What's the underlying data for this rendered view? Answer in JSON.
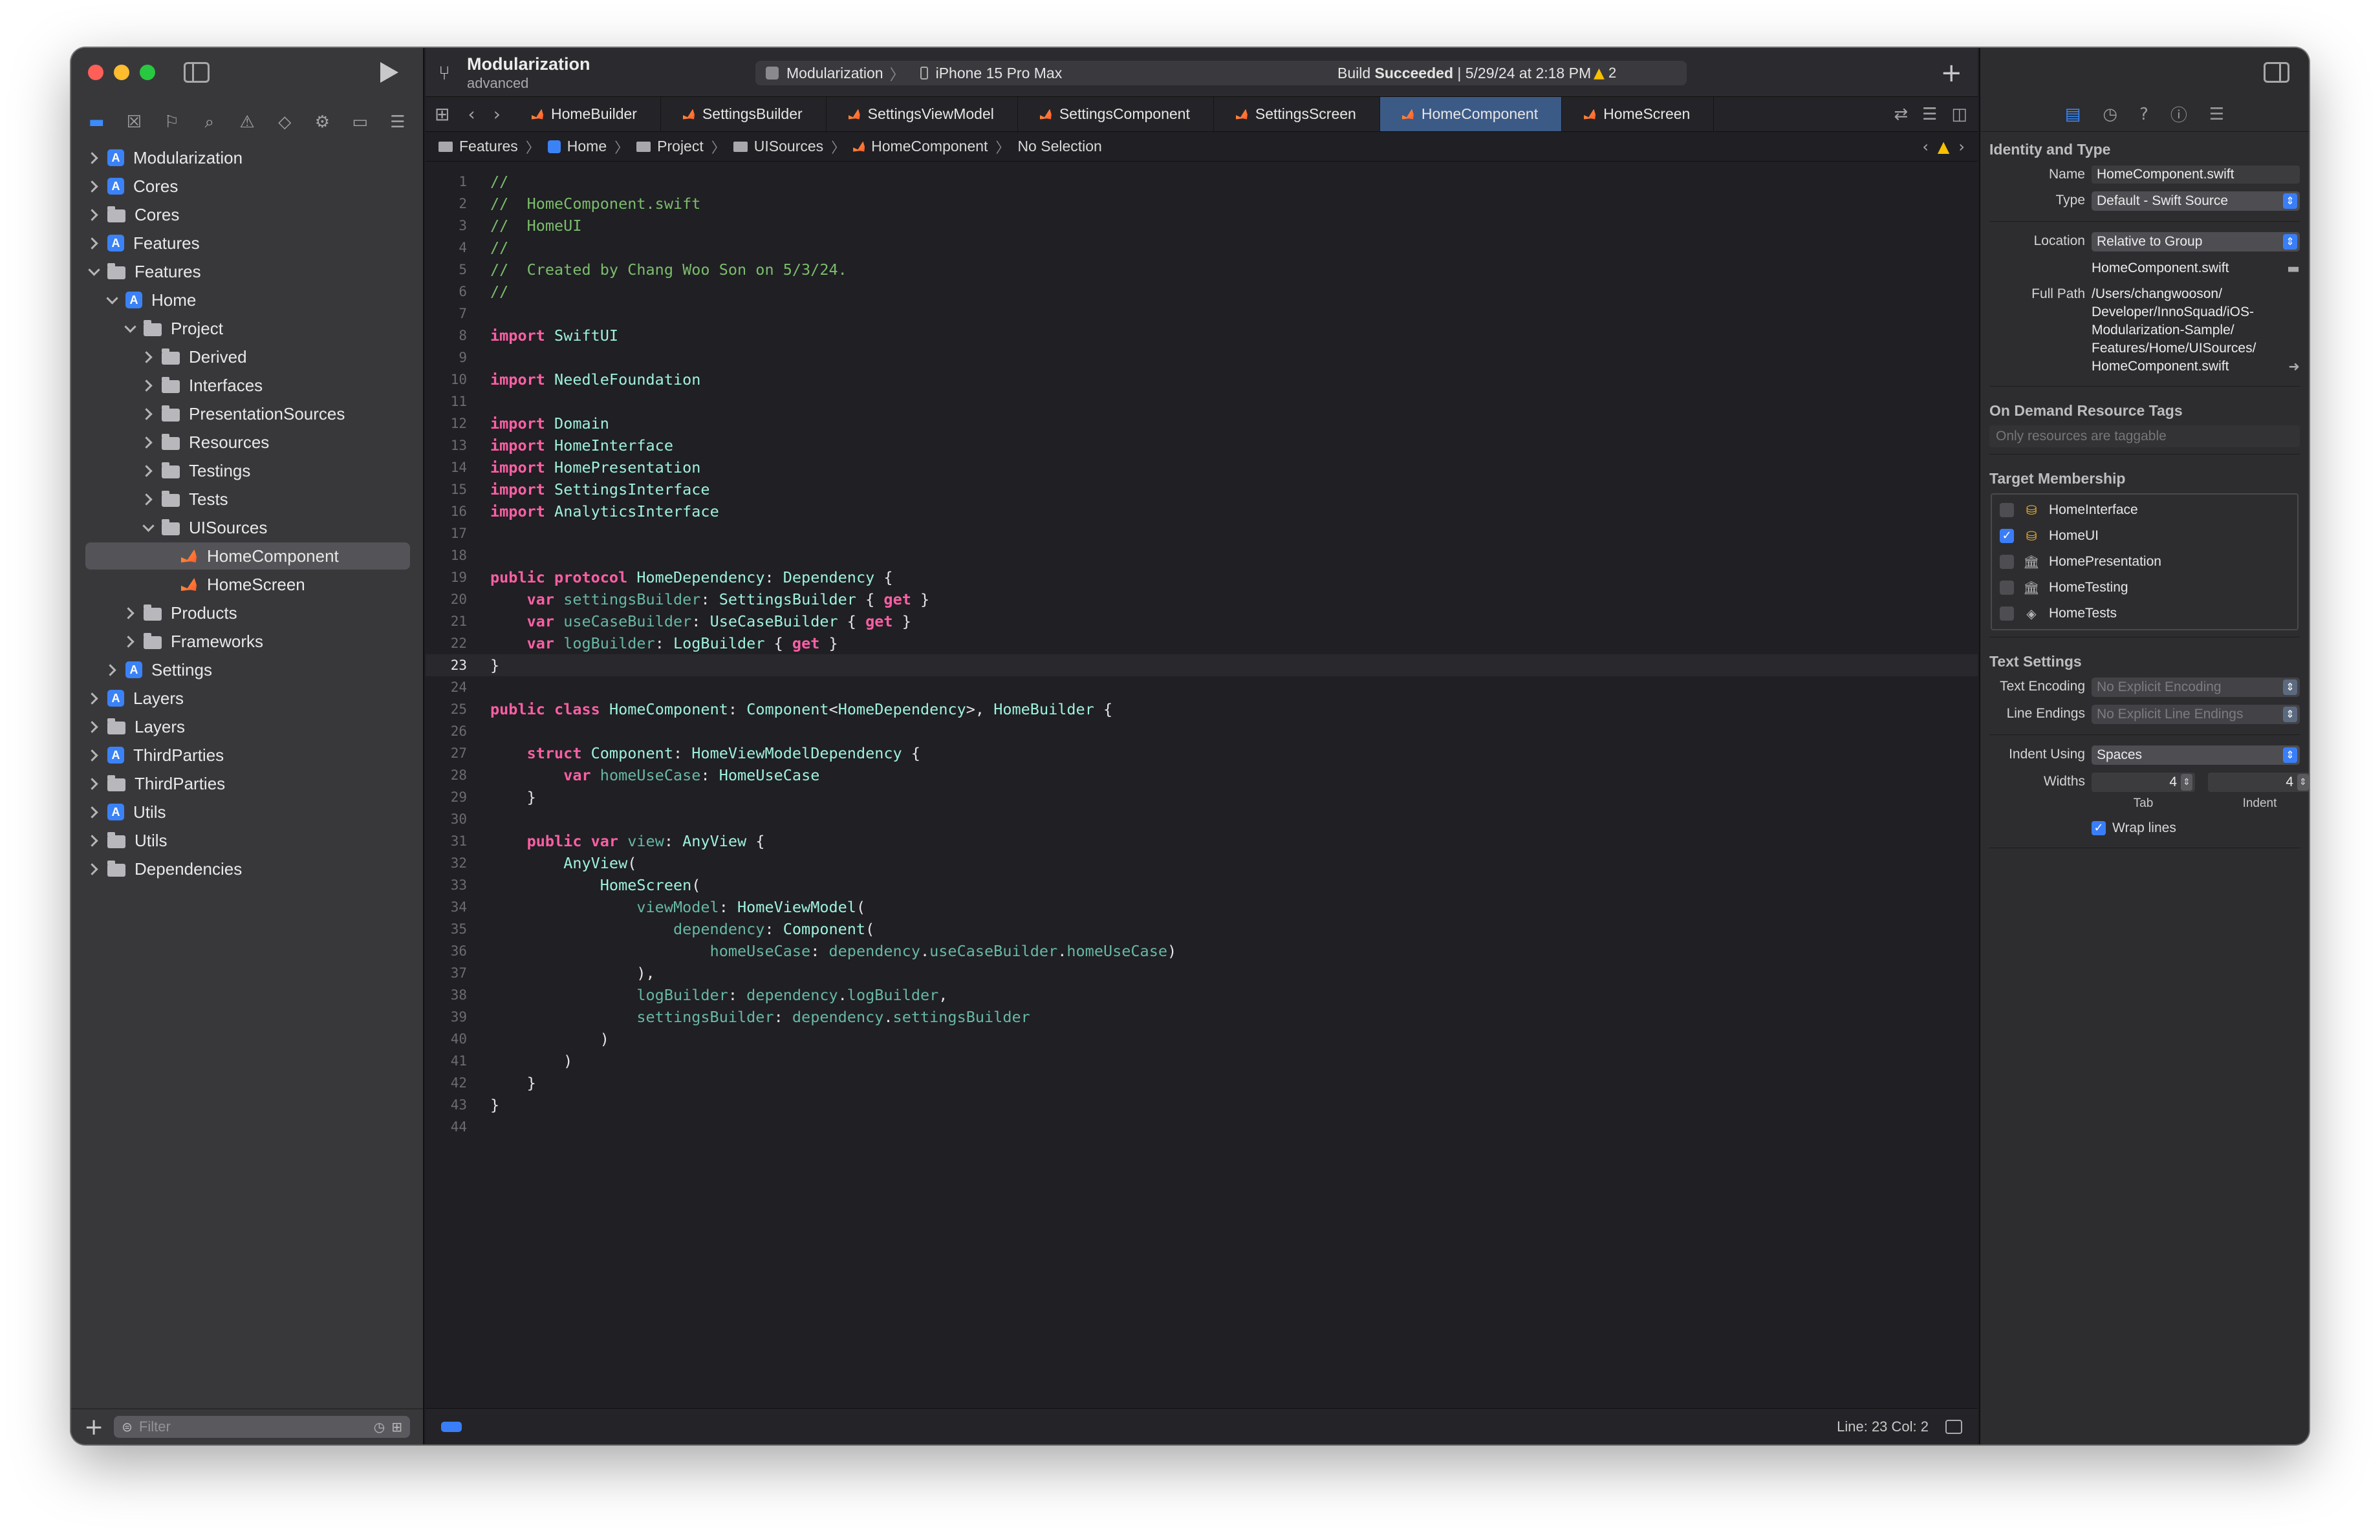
{
  "toolbar": {
    "project_name": "Modularization",
    "branch": "advanced",
    "scheme": "Modularization",
    "device": "iPhone 15 Pro Max",
    "build_status_label": "Build ",
    "build_status_strong": "Succeeded",
    "build_status_time": " | 5/29/24 at 2:18 PM",
    "warning_count": "2"
  },
  "tabs": [
    {
      "label": "HomeBuilder",
      "active": false
    },
    {
      "label": "SettingsBuilder",
      "active": false
    },
    {
      "label": "SettingsViewModel",
      "active": false
    },
    {
      "label": "SettingsComponent",
      "active": false
    },
    {
      "label": "SettingsScreen",
      "active": false
    },
    {
      "label": "HomeComponent",
      "active": true
    },
    {
      "label": "HomeScreen",
      "active": false
    }
  ],
  "jumpbar": [
    "Features",
    "Home",
    "Project",
    "UISources",
    "HomeComponent",
    "No Selection"
  ],
  "navigator": {
    "items": [
      {
        "label": "Modularization",
        "depth": 0,
        "chevron": "right",
        "icon": "app"
      },
      {
        "label": "Cores",
        "depth": 0,
        "chevron": "right",
        "icon": "app"
      },
      {
        "label": "Cores",
        "depth": 0,
        "chevron": "right",
        "icon": "folder"
      },
      {
        "label": "Features",
        "depth": 0,
        "chevron": "right",
        "icon": "app"
      },
      {
        "label": "Features",
        "depth": 0,
        "chevron": "down",
        "icon": "folder"
      },
      {
        "label": "Home",
        "depth": 1,
        "chevron": "down",
        "icon": "app"
      },
      {
        "label": "Project",
        "depth": 2,
        "chevron": "down",
        "icon": "folder"
      },
      {
        "label": "Derived",
        "depth": 3,
        "chevron": "right",
        "icon": "folder"
      },
      {
        "label": "Interfaces",
        "depth": 3,
        "chevron": "right",
        "icon": "folder"
      },
      {
        "label": "PresentationSources",
        "depth": 3,
        "chevron": "right",
        "icon": "folder"
      },
      {
        "label": "Resources",
        "depth": 3,
        "chevron": "right",
        "icon": "folder"
      },
      {
        "label": "Testings",
        "depth": 3,
        "chevron": "right",
        "icon": "folder"
      },
      {
        "label": "Tests",
        "depth": 3,
        "chevron": "right",
        "icon": "folder"
      },
      {
        "label": "UISources",
        "depth": 3,
        "chevron": "down",
        "icon": "folder"
      },
      {
        "label": "HomeComponent",
        "depth": 4,
        "chevron": "none",
        "icon": "swift",
        "selected": true
      },
      {
        "label": "HomeScreen",
        "depth": 4,
        "chevron": "none",
        "icon": "swift"
      },
      {
        "label": "Products",
        "depth": 2,
        "chevron": "right",
        "icon": "folder"
      },
      {
        "label": "Frameworks",
        "depth": 2,
        "chevron": "right",
        "icon": "folder"
      },
      {
        "label": "Settings",
        "depth": 1,
        "chevron": "right",
        "icon": "app"
      },
      {
        "label": "Layers",
        "depth": 0,
        "chevron": "right",
        "icon": "app"
      },
      {
        "label": "Layers",
        "depth": 0,
        "chevron": "right",
        "icon": "folder"
      },
      {
        "label": "ThirdParties",
        "depth": 0,
        "chevron": "right",
        "icon": "app"
      },
      {
        "label": "ThirdParties",
        "depth": 0,
        "chevron": "right",
        "icon": "folder"
      },
      {
        "label": "Utils",
        "depth": 0,
        "chevron": "right",
        "icon": "app"
      },
      {
        "label": "Utils",
        "depth": 0,
        "chevron": "right",
        "icon": "folder"
      },
      {
        "label": "Dependencies",
        "depth": 0,
        "chevron": "right",
        "icon": "folder"
      }
    ],
    "filter_placeholder": "Filter"
  },
  "editor": {
    "current_line": 23,
    "lines": [
      "//",
      "//  HomeComponent.swift",
      "//  HomeUI",
      "//",
      "//  Created by Chang Woo Son on 5/3/24.",
      "//",
      "",
      "import SwiftUI",
      "",
      "import NeedleFoundation",
      "",
      "import Domain",
      "import HomeInterface",
      "import HomePresentation",
      "import SettingsInterface",
      "import AnalyticsInterface",
      "",
      "",
      "public protocol HomeDependency: Dependency {",
      "    var settingsBuilder: SettingsBuilder { get }",
      "    var useCaseBuilder: UseCaseBuilder { get }",
      "    var logBuilder: LogBuilder { get }",
      "}",
      "",
      "public class HomeComponent: Component<HomeDependency>, HomeBuilder {",
      "",
      "    struct Component: HomeViewModelDependency {",
      "        var homeUseCase: HomeUseCase",
      "    }",
      "",
      "    public var view: AnyView {",
      "        AnyView(",
      "            HomeScreen(",
      "                viewModel: HomeViewModel(",
      "                    dependency: Component(",
      "                        homeUseCase: dependency.useCaseBuilder.homeUseCase)",
      "                ),",
      "                logBuilder: dependency.logBuilder,",
      "                settingsBuilder: dependency.settingsBuilder",
      "            )",
      "        )",
      "    }",
      "}",
      ""
    ],
    "status_line_col": "Line: 23  Col: 2"
  },
  "inspector": {
    "identity_title": "Identity and Type",
    "name_label": "Name",
    "name_value": "HomeComponent.swift",
    "type_label": "Type",
    "type_value": "Default - Swift Source",
    "location_label": "Location",
    "location_value": "Relative to Group",
    "location_file": "HomeComponent.swift",
    "fullpath_label": "Full Path",
    "fullpath_lines": [
      "/Users/changwooson/",
      "Developer/InnoSquad/iOS-",
      "Modularization-Sample/",
      "Features/Home/UISources/",
      "HomeComponent.swift"
    ],
    "ondemand_title": "On Demand Resource Tags",
    "ondemand_placeholder": "Only resources are taggable",
    "membership_title": "Target Membership",
    "targets": [
      {
        "label": "HomeInterface",
        "checked": false,
        "icon": "framework"
      },
      {
        "label": "HomeUI",
        "checked": true,
        "icon": "framework"
      },
      {
        "label": "HomePresentation",
        "checked": false,
        "icon": "library"
      },
      {
        "label": "HomeTesting",
        "checked": false,
        "icon": "library"
      },
      {
        "label": "HomeTests",
        "checked": false,
        "icon": "test"
      }
    ],
    "text_settings_title": "Text Settings",
    "encoding_label": "Text Encoding",
    "encoding_value": "No Explicit Encoding",
    "endings_label": "Line Endings",
    "endings_value": "No Explicit Line Endings",
    "indent_label": "Indent Using",
    "indent_value": "Spaces",
    "widths_label": "Widths",
    "tab_width": "4",
    "tab_caption": "Tab",
    "indent_width": "4",
    "indent_caption": "Indent",
    "wrap_label": "Wrap lines",
    "wrap_checked": true
  }
}
